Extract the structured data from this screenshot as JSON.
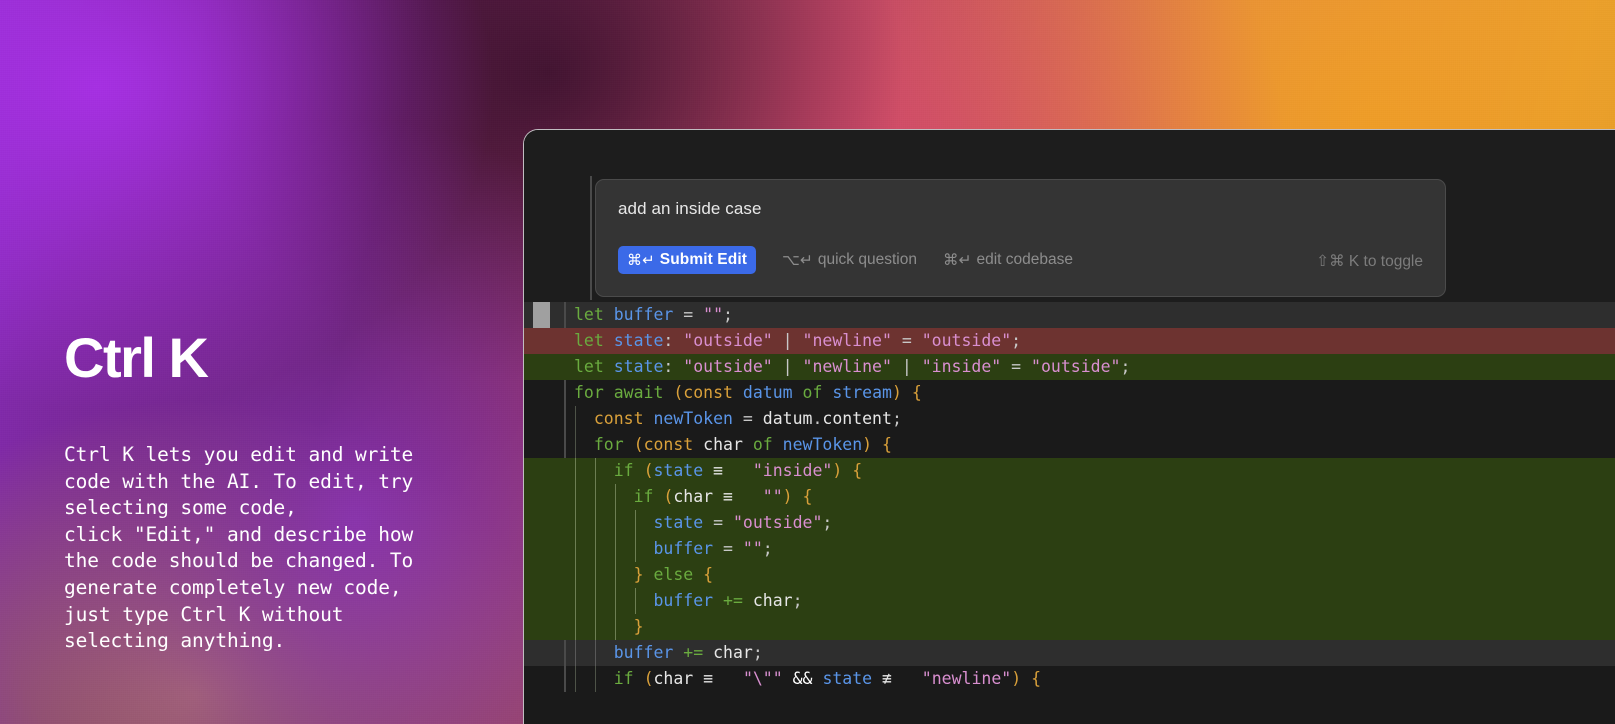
{
  "background": {
    "accent_purple": "#8e2ec8",
    "accent_pink": "#b2465f",
    "accent_orange": "#e8a22e"
  },
  "left_panel": {
    "title": "Ctrl K",
    "description": "Ctrl K lets you edit and write\ncode with the AI. To edit, try\nselecting some code,\nclick \"Edit,\" and describe how\nthe code should be changed. To\ngenerate completely new code,\njust type Ctrl K without\nselecting anything."
  },
  "prompt": {
    "value": "add an inside case",
    "submit_label": "Submit Edit",
    "submit_shortcut": "⌘↵",
    "submit_color": "#3b6ae8",
    "hints": [
      {
        "shortcut": "⌥↵",
        "label": "quick question"
      },
      {
        "shortcut": "⌘↵",
        "label": "edit codebase"
      }
    ],
    "toggle_hint": "⇧⌘ K to toggle"
  },
  "editor": {
    "background": "#1a1a1a",
    "diff_removed_color": "#6d3330",
    "diff_added_color": "#2c3f12",
    "current_line_color": "#2e2e2e",
    "lines": [
      {
        "text": "let buffer = \"\";",
        "state": "current"
      },
      {
        "text": "let state: \"outside\" | \"newline\" = \"outside\";",
        "state": "removed"
      },
      {
        "text": "let state: \"outside\" | \"newline\" | \"inside\" = \"outside\";",
        "state": "added"
      },
      {
        "text": "for await (const datum of stream) {",
        "state": "normal"
      },
      {
        "text": "  const newToken = datum.content;",
        "state": "normal"
      },
      {
        "text": "  for (const char of newToken) {",
        "state": "normal"
      },
      {
        "text": "    if (state === \"inside\") {",
        "state": "added"
      },
      {
        "text": "      if (char === \"\") {",
        "state": "added"
      },
      {
        "text": "        state = \"outside\";",
        "state": "added"
      },
      {
        "text": "        buffer = \"\";",
        "state": "added"
      },
      {
        "text": "      } else {",
        "state": "added"
      },
      {
        "text": "        buffer += char;",
        "state": "added"
      },
      {
        "text": "      }",
        "state": "added"
      },
      {
        "text": "    buffer += char;",
        "state": "current"
      },
      {
        "text": "    if (char === \"\\\"\" && state !== \"newline\") {",
        "state": "normal"
      }
    ]
  }
}
